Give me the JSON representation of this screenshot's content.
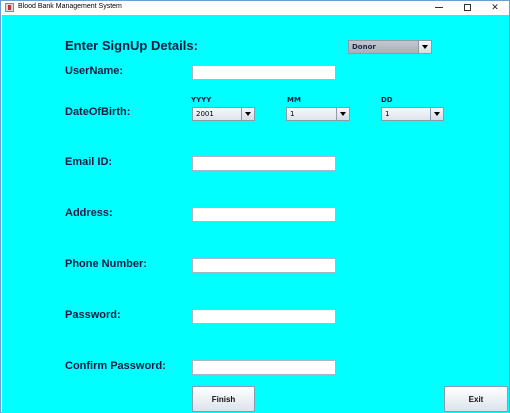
{
  "window": {
    "title": "Blood Bank Management System"
  },
  "form": {
    "heading": "Enter SignUp Details:",
    "role_select": {
      "value": "Donor"
    },
    "labels": {
      "username": "UserName:",
      "dob": "DateOfBirth:",
      "email": "Email ID:",
      "address": "Address:",
      "phone": "Phone Number:",
      "password": "Password:",
      "confirm_password": "Confirm Password:"
    },
    "dob": {
      "year_label": "YYYY",
      "month_label": "MM",
      "day_label": "DD",
      "year_value": "2001",
      "month_value": "1",
      "day_value": "1"
    },
    "fields": {
      "username": "",
      "email": "",
      "address": "",
      "phone": "",
      "password": "",
      "confirm_password": ""
    }
  },
  "buttons": {
    "finish": "Finish",
    "exit": "Exit"
  },
  "colors": {
    "background": "#00ffff",
    "label_text": "#1a1a40"
  }
}
